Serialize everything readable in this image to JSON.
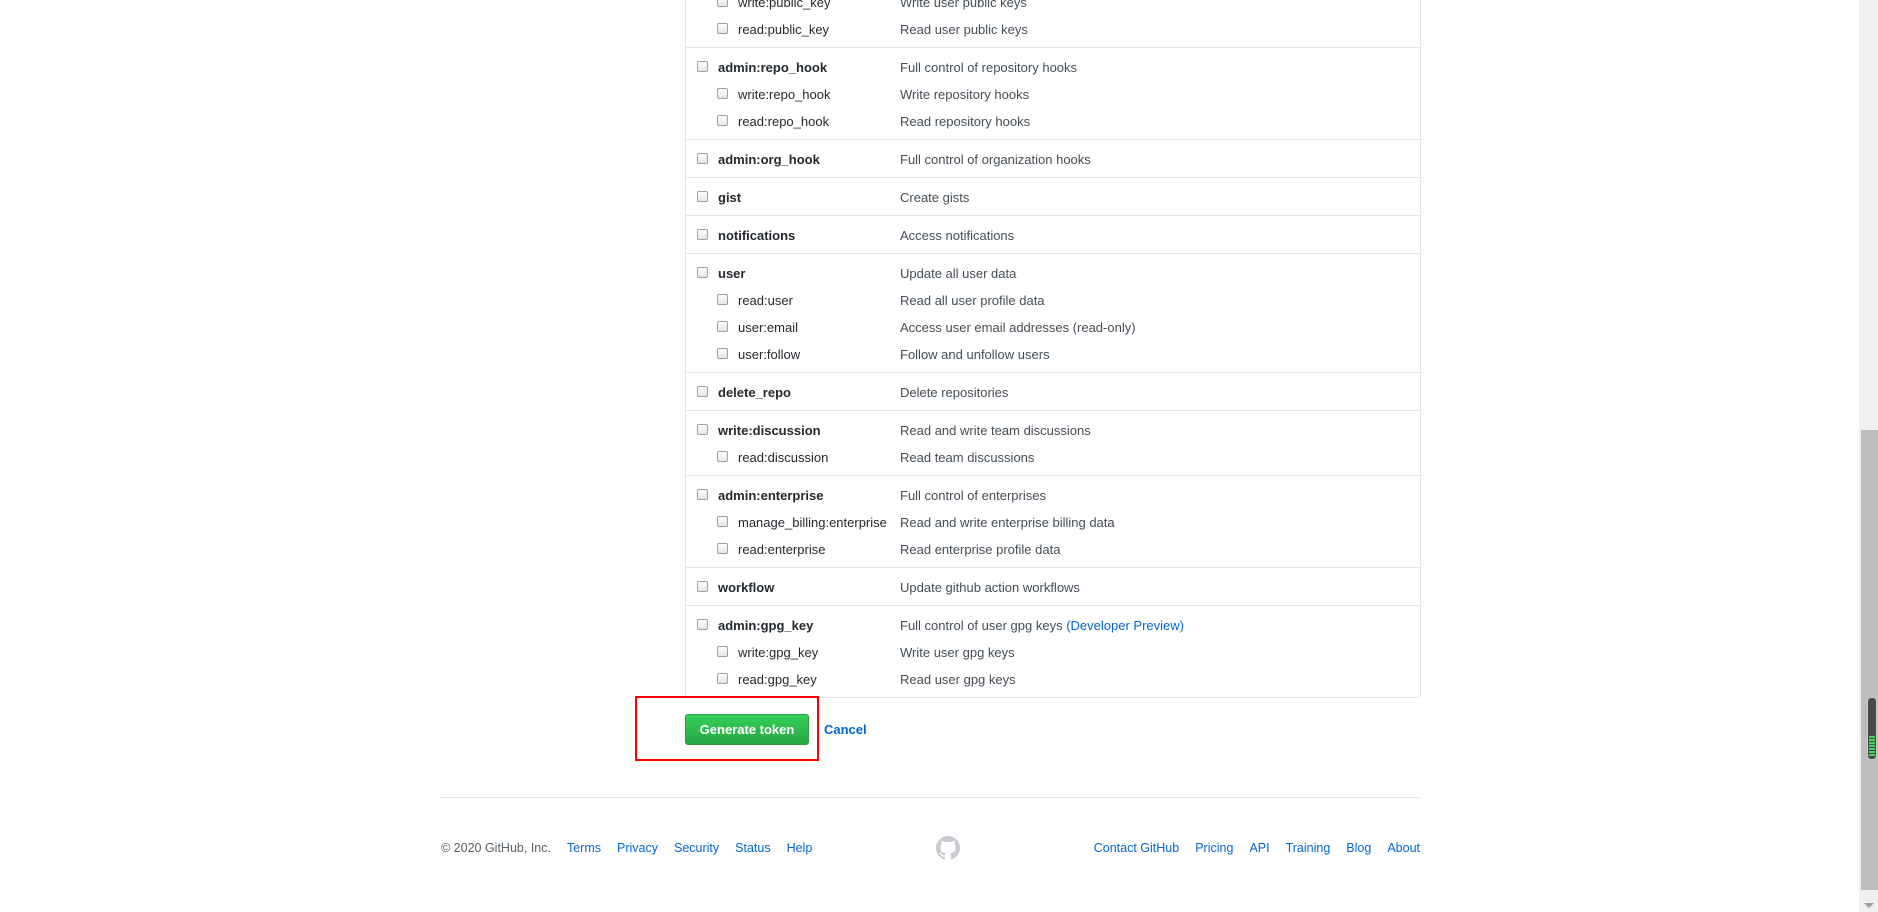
{
  "scopes": [
    {
      "rows": [
        {
          "label": "write:public_key",
          "desc": "Write user public keys",
          "level": "child"
        },
        {
          "label": "read:public_key",
          "desc": "Read user public keys",
          "level": "child"
        }
      ]
    },
    {
      "rows": [
        {
          "label": "admin:repo_hook",
          "desc": "Full control of repository hooks",
          "level": "parent"
        },
        {
          "label": "write:repo_hook",
          "desc": "Write repository hooks",
          "level": "child"
        },
        {
          "label": "read:repo_hook",
          "desc": "Read repository hooks",
          "level": "child"
        }
      ]
    },
    {
      "rows": [
        {
          "label": "admin:org_hook",
          "desc": "Full control of organization hooks",
          "level": "parent"
        }
      ]
    },
    {
      "rows": [
        {
          "label": "gist",
          "desc": "Create gists",
          "level": "parent"
        }
      ]
    },
    {
      "rows": [
        {
          "label": "notifications",
          "desc": "Access notifications",
          "level": "parent"
        }
      ]
    },
    {
      "rows": [
        {
          "label": "user",
          "desc": "Update all user data",
          "level": "parent"
        },
        {
          "label": "read:user",
          "desc": "Read all user profile data",
          "level": "child"
        },
        {
          "label": "user:email",
          "desc": "Access user email addresses (read-only)",
          "level": "child"
        },
        {
          "label": "user:follow",
          "desc": "Follow and unfollow users",
          "level": "child"
        }
      ]
    },
    {
      "rows": [
        {
          "label": "delete_repo",
          "desc": "Delete repositories",
          "level": "parent"
        }
      ]
    },
    {
      "rows": [
        {
          "label": "write:discussion",
          "desc": "Read and write team discussions",
          "level": "parent"
        },
        {
          "label": "read:discussion",
          "desc": "Read team discussions",
          "level": "child"
        }
      ]
    },
    {
      "rows": [
        {
          "label": "admin:enterprise",
          "desc": "Full control of enterprises",
          "level": "parent"
        },
        {
          "label": "manage_billing:enterprise",
          "desc": "Read and write enterprise billing data",
          "level": "child"
        },
        {
          "label": "read:enterprise",
          "desc": "Read enterprise profile data",
          "level": "child"
        }
      ]
    },
    {
      "rows": [
        {
          "label": "workflow",
          "desc": "Update github action workflows",
          "level": "parent"
        }
      ]
    },
    {
      "rows": [
        {
          "label": "admin:gpg_key",
          "desc": "Full control of user gpg keys",
          "link": "(Developer Preview)",
          "level": "parent"
        },
        {
          "label": "write:gpg_key",
          "desc": "Write user gpg keys",
          "level": "child"
        },
        {
          "label": "read:gpg_key",
          "desc": "Read user gpg keys",
          "level": "child"
        }
      ]
    }
  ],
  "actions": {
    "generate": "Generate token",
    "cancel": "Cancel"
  },
  "footer": {
    "copyright": "© 2020 GitHub, Inc.",
    "left_links": [
      "Terms",
      "Privacy",
      "Security",
      "Status",
      "Help"
    ],
    "right_links": [
      "Contact GitHub",
      "Pricing",
      "API",
      "Training",
      "Blog",
      "About"
    ]
  },
  "colors": {
    "accent": "#0366d6",
    "button": "#28a745",
    "highlight": "#ff0000"
  }
}
